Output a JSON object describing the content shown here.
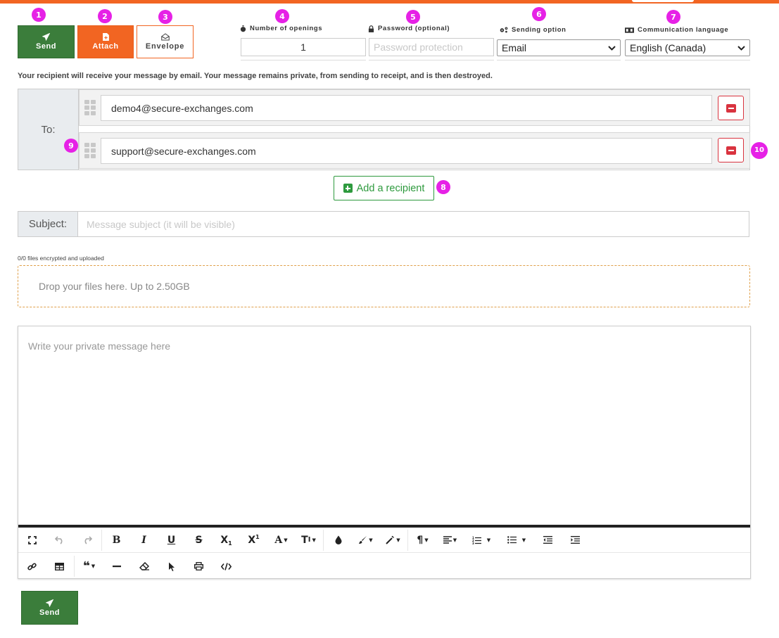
{
  "badges": {
    "send": "1",
    "attach": "2",
    "envelope": "3",
    "openings": "4",
    "password": "5",
    "sending_option": "6",
    "language": "7",
    "add_recipient": "8",
    "recipient_row": "9",
    "remove_recipient": "10"
  },
  "toolbar": {
    "send_label": "Send",
    "attach_label": "Attach",
    "envelope_label": "Envelope"
  },
  "options": {
    "openings_label": "Number of openings",
    "openings_value": "1",
    "password_label": "Password (optional)",
    "password_placeholder": "Password protection",
    "sending_label": "Sending option",
    "sending_value": "Email",
    "language_label": "Communication language",
    "language_value": "English (Canada)"
  },
  "info_text": "Your recipient will receive your message by email. Your message remains private, from sending to receipt, and is then destroyed.",
  "recipients": {
    "to_label": "To:",
    "items": [
      "demo4@secure-exchanges.com",
      "support@secure-exchanges.com"
    ],
    "add_label": "Add a recipient"
  },
  "subject": {
    "label": "Subject:",
    "placeholder": "Message subject (it will be visible)"
  },
  "files": {
    "count_text": "0/0 files encrypted and uploaded",
    "drop_text": "Drop your files here. Up to 2.50GB"
  },
  "editor": {
    "placeholder": "Write your private message here"
  },
  "colors": {
    "brand_orange": "#f26522",
    "send_green": "#3b7d3b",
    "remove_red": "#d9333f",
    "add_green": "#2e9a3e",
    "badge_magenta": "#e621e6"
  }
}
